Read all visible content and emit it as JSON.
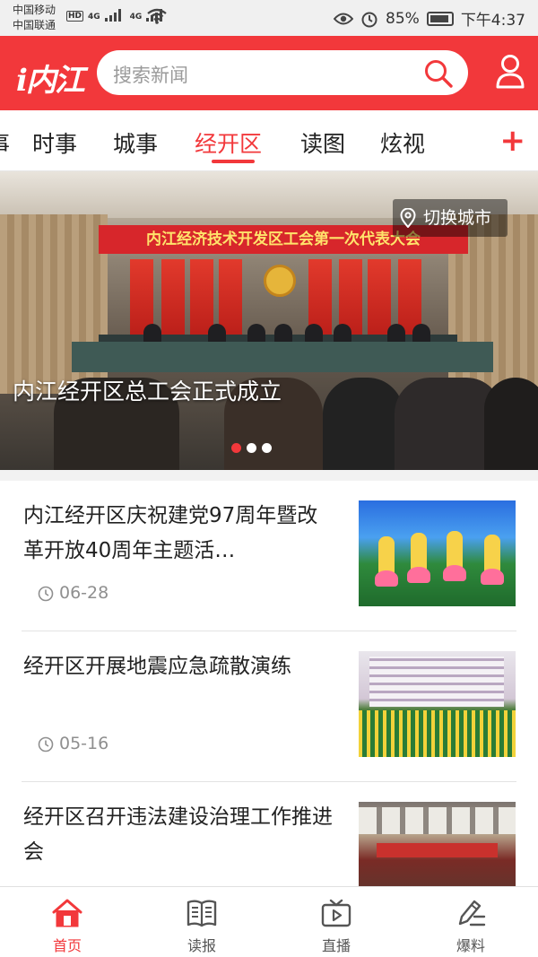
{
  "status_bar": {
    "carrier_1": "中国移动",
    "carrier_2": "中国联通",
    "hd_tag": "HD",
    "network_1": "4G",
    "network_2": "4G",
    "battery": "85%",
    "time": "下午4:37",
    "icons": [
      "signal-icon",
      "wifi-icon",
      "eye-icon",
      "alarm-icon",
      "battery-icon"
    ]
  },
  "header": {
    "logo_text": "i内江",
    "search_placeholder": "搜索新闻",
    "brand_color": "#f2383b"
  },
  "tabs": {
    "items": [
      {
        "label": "时事"
      },
      {
        "label": "城事"
      },
      {
        "label": "经开区",
        "active": true
      },
      {
        "label": "读图"
      },
      {
        "label": "炫视"
      }
    ],
    "add_label": "+"
  },
  "banner": {
    "location_chip": "切换城市",
    "title": "内江经开区总工会正式成立",
    "photo_banner_text": "内江经济技术开发区工会第一次代表大会",
    "slides_total": 3,
    "active_slide": 1
  },
  "news": [
    {
      "title": "内江经开区庆祝建党97周年暨改革开放40周年主题活…",
      "date": "06-28"
    },
    {
      "title": "经开区开展地震应急疏散演练",
      "date": "05-16"
    },
    {
      "title": "经开区召开违法建设治理工作推进会",
      "date": ""
    }
  ],
  "bottom_nav": [
    {
      "label": "首页",
      "icon": "home-icon",
      "active": true
    },
    {
      "label": "读报",
      "icon": "book-icon"
    },
    {
      "label": "直播",
      "icon": "tv-play-icon"
    },
    {
      "label": "爆料",
      "icon": "edit-list-icon"
    }
  ]
}
